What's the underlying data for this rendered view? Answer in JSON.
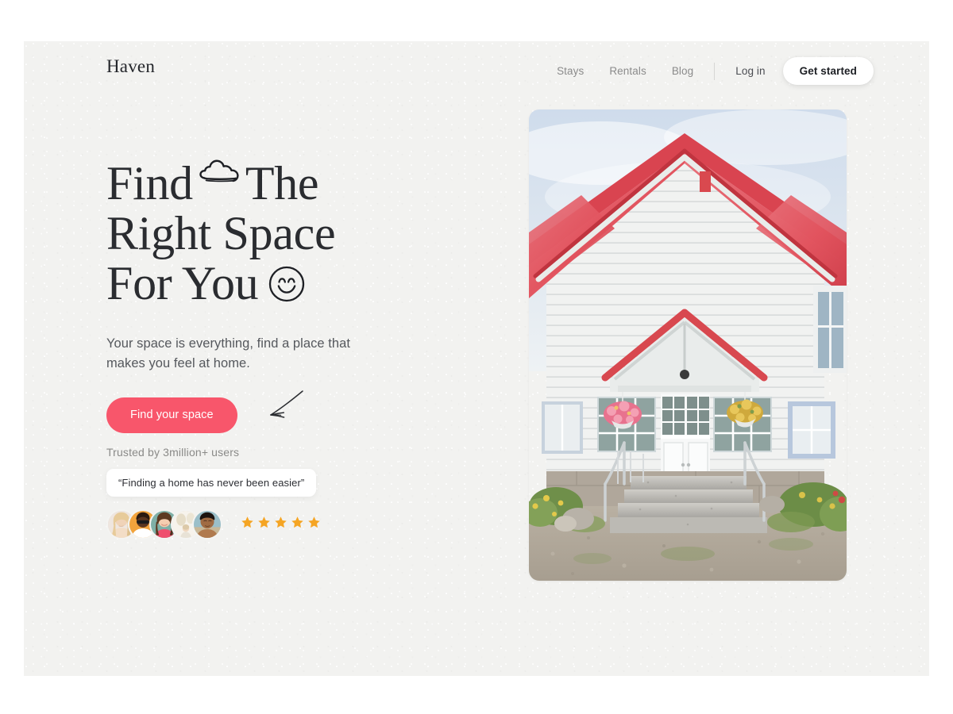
{
  "brand": {
    "name": "Haven"
  },
  "nav": {
    "links": [
      {
        "label": "Stays"
      },
      {
        "label": "Rentals"
      },
      {
        "label": "Blog"
      }
    ],
    "login_label": "Log in",
    "cta_label": "Get started"
  },
  "hero": {
    "headline_line1": "Find",
    "headline_line1b": "The",
    "headline_line2": "Right Space",
    "headline_line3": "For You",
    "subtitle": "Your space is everything, find a place that makes you feel at home.",
    "cta_label": "Find your space",
    "cloud_icon": "cloud-doodle-icon",
    "smiley_icon": "smiley-face-doodle-icon",
    "arrow_icon": "hand-drawn-arrow-icon"
  },
  "trust": {
    "label": "Trusted by 3million+ users",
    "quote": "“Finding a home has never been easier”",
    "avatar_count": 5,
    "star_count": 5
  },
  "image": {
    "alt": "White clapboard house with red metal roof, porch entrance, granite steps and hanging flower baskets"
  },
  "colors": {
    "accent": "#f8566b",
    "star": "#f5a524",
    "page_bg": "#f2f2f0",
    "text_dark": "#2a2c30",
    "text_muted": "#8b8b8b"
  }
}
